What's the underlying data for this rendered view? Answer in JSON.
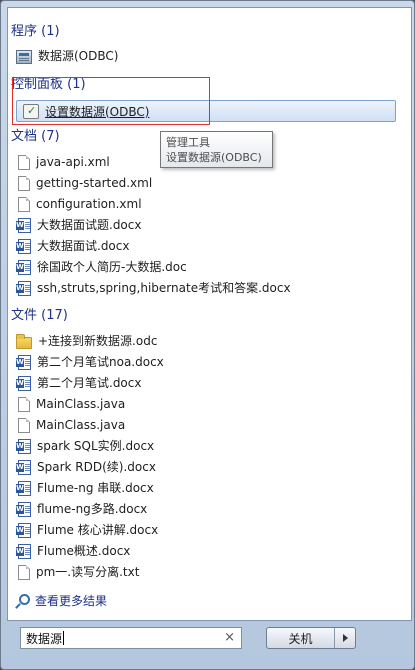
{
  "groups": {
    "programs": {
      "header": "程序 (1)",
      "items": [
        {
          "label": "数据源(ODBC)",
          "icon": "odbc-icon"
        }
      ]
    },
    "control_panel": {
      "header": "控制面板 (1)",
      "items": [
        {
          "label": "设置数据源(ODBC)",
          "icon": "odbc-settings-icon"
        }
      ]
    },
    "documents": {
      "header": "文档 (7)",
      "items": [
        {
          "label": "java-api.xml",
          "icon": "text-file-icon"
        },
        {
          "label": "getting-started.xml",
          "icon": "text-file-icon"
        },
        {
          "label": "configuration.xml",
          "icon": "text-file-icon"
        },
        {
          "label": "大数据面试题.docx",
          "icon": "word-doc-icon"
        },
        {
          "label": "大数据面试.docx",
          "icon": "word-doc-icon"
        },
        {
          "label": "徐国政个人简历-大数据.doc",
          "icon": "word-doc-icon"
        },
        {
          "label": "ssh,struts,spring,hibernate考试和答案.docx",
          "icon": "word-doc-icon"
        }
      ]
    },
    "files": {
      "header": "文件 (17)",
      "items": [
        {
          "label": "+连接到新数据源.odc",
          "icon": "folder-icon"
        },
        {
          "label": "第二个月笔试noa.docx",
          "icon": "word-doc-icon"
        },
        {
          "label": "第二个月笔试.docx",
          "icon": "word-doc-icon"
        },
        {
          "label": "MainClass.java",
          "icon": "text-file-icon"
        },
        {
          "label": "MainClass.java",
          "icon": "text-file-icon"
        },
        {
          "label": "spark SQL实例.docx",
          "icon": "word-doc-icon"
        },
        {
          "label": "Spark RDD(续).docx",
          "icon": "word-doc-icon"
        },
        {
          "label": "Flume-ng 串联.docx",
          "icon": "word-doc-icon"
        },
        {
          "label": "flume-ng多路.docx",
          "icon": "word-doc-icon"
        },
        {
          "label": "Flume 核心讲解.docx",
          "icon": "word-doc-icon"
        },
        {
          "label": "Flume概述.docx",
          "icon": "word-doc-icon"
        },
        {
          "label": "pm一.读写分离.txt",
          "icon": "text-file-icon"
        }
      ]
    }
  },
  "tooltip": {
    "line1": "管理工具",
    "line2": "设置数据源(ODBC)"
  },
  "see_more": "查看更多结果",
  "search": {
    "value": "数据源",
    "clear": "×"
  },
  "shutdown": {
    "label": "关机"
  },
  "colors": {
    "header_text": "#1e3287",
    "highlight_box": "#e0302e",
    "selected_border": "#7da2ce"
  }
}
